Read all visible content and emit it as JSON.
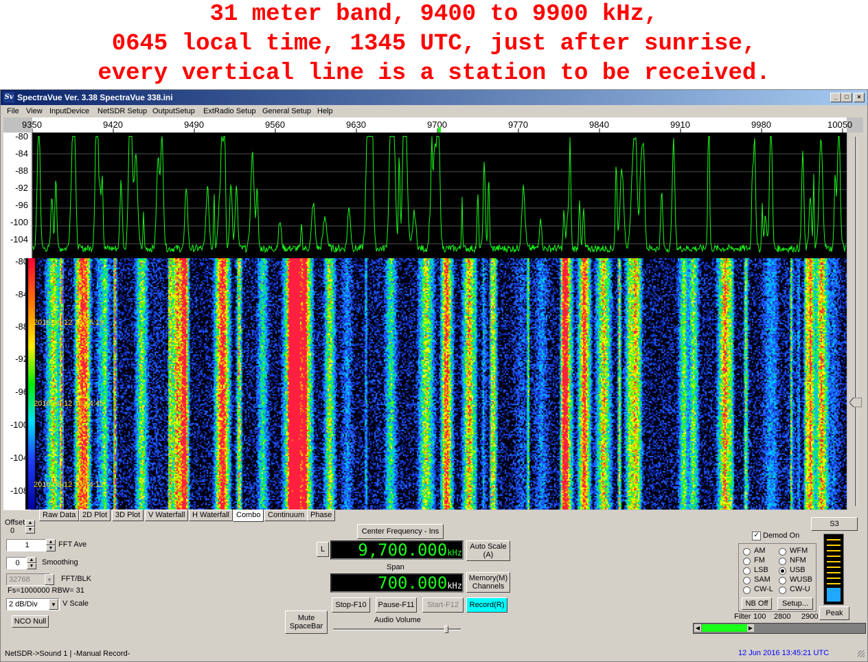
{
  "caption": {
    "line1": "31 meter band, 9400 to 9900 kHz,",
    "line2": "0645 local time, 1345 UTC, just after sunrise,",
    "line3": "every vertical line is a station to be received."
  },
  "window": {
    "title": "SpectraVue Ver. 3.38  SpectraVue 338.ini",
    "icon": "Sv",
    "minimize_glyph": "_",
    "maximize_glyph": "□",
    "close_glyph": "×"
  },
  "menu": [
    "File",
    "View",
    "InputDevice",
    "NetSDR Setup",
    "OutputSetup",
    "ExtRadio Setup",
    "General Setup",
    "Help"
  ],
  "freq_axis": [
    "9350",
    "9420",
    "9490",
    "9560",
    "9630",
    "9700",
    "9770",
    "9840",
    "9910",
    "9980",
    "10050"
  ],
  "spectrum_axis": [
    "-80",
    "-84",
    "-88",
    "-92",
    "-96",
    "-100",
    "-104"
  ],
  "waterfall_axis": [
    "-80",
    "-84",
    "-88",
    "-92",
    "-96",
    "-100",
    "-104",
    "-108"
  ],
  "timestamps": [
    "2016-06-12 13:45:19",
    "2016-06-12 13:44:45",
    "2016-06-12 13:44:12"
  ],
  "tabs": [
    "Raw Data",
    "2D Plot",
    "3D Plot",
    "V Waterfall",
    "H Waterfall",
    "Combo",
    "Continuum",
    "Phase"
  ],
  "active_tab": "Combo",
  "controls": {
    "offset_label": "Offset",
    "offset_value": "0",
    "fft_ave_value": "1",
    "fft_ave_label": "FFT Ave",
    "smoothing_value": "0",
    "smoothing_label": "Smoothing",
    "fft_blk_value": "32768",
    "fft_blk_label": "FFT/BLK",
    "fs_text": "Fs=1000000 RBW=  31",
    "vscale_value": "2 dB/Div",
    "vscale_label": "V Scale",
    "nco_null": "NCO Null",
    "mute_line1": "Mute",
    "mute_line2": "SpaceBar",
    "center_freq_button": "Center Frequency - Ins",
    "l_button": "L",
    "center_freq_value": "9,700.000",
    "khz": "kHz",
    "span_label": "Span",
    "span_value": "700.000",
    "auto_scale_line1": "Auto Scale",
    "auto_scale_line2": "(A)",
    "memory_line1": "Memory(M)",
    "memory_line2": "Channels",
    "stop": "Stop-F10",
    "pause": "Pause-F11",
    "start": "Start-F12",
    "record": "Record(R)",
    "audio_volume": "Audio Volume",
    "audio_volume_level": 0.9
  },
  "demod": {
    "demod_on_label": "Demod On",
    "demod_on_checked": true,
    "modes_left": [
      "AM",
      "FM",
      "LSB",
      "SAM",
      "CW-L"
    ],
    "modes_right": [
      "WFM",
      "NFM",
      "USB",
      "WUSB",
      "CW-U"
    ],
    "selected": "USB",
    "nb_off": "NB Off",
    "setup": "Setup...",
    "s_meter": "S3",
    "peak": "Peak",
    "filter_label": "Filter",
    "filter_values": [
      "100",
      "2800",
      "2900"
    ]
  },
  "status": {
    "left": "NetSDR->Sound 1  | -Manual Record-",
    "right": "12 Jun 2016  13:45:21 UTC"
  },
  "colors": {
    "caption": "#ff0000",
    "trace": "#19ff19",
    "record_button": "#00ffff",
    "date_text": "#0000ff",
    "lcd_text": "#19ff19"
  }
}
